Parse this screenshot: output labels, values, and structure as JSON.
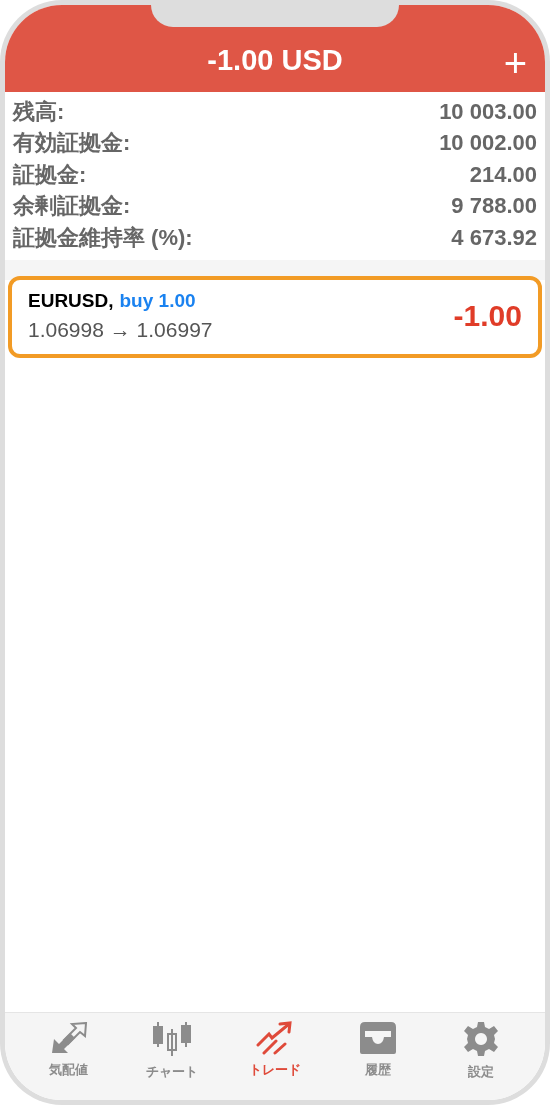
{
  "header": {
    "title": "-1.00 USD",
    "add_button": "+"
  },
  "account": [
    {
      "label": "残高:",
      "value": "10 003.00"
    },
    {
      "label": "有効証拠金:",
      "value": "10 002.00"
    },
    {
      "label": "証拠金:",
      "value": "214.00"
    },
    {
      "label": "余剰証拠金:",
      "value": "9 788.00"
    },
    {
      "label": "証拠金維持率 (%):",
      "value": "4 673.92"
    }
  ],
  "positions": [
    {
      "symbol": "EURUSD,",
      "order": "buy 1.00",
      "prices": "1.06998 → 1.06997",
      "profit": "-1.00",
      "highlighted": true
    }
  ],
  "tabs": [
    {
      "kind": "quotes",
      "label": "気配値",
      "selected": false
    },
    {
      "kind": "chart",
      "label": "チャート",
      "selected": false
    },
    {
      "kind": "trade",
      "label": "トレード",
      "selected": true
    },
    {
      "kind": "history",
      "label": "履歴",
      "selected": false
    },
    {
      "kind": "settings",
      "label": "設定",
      "selected": false
    }
  ]
}
